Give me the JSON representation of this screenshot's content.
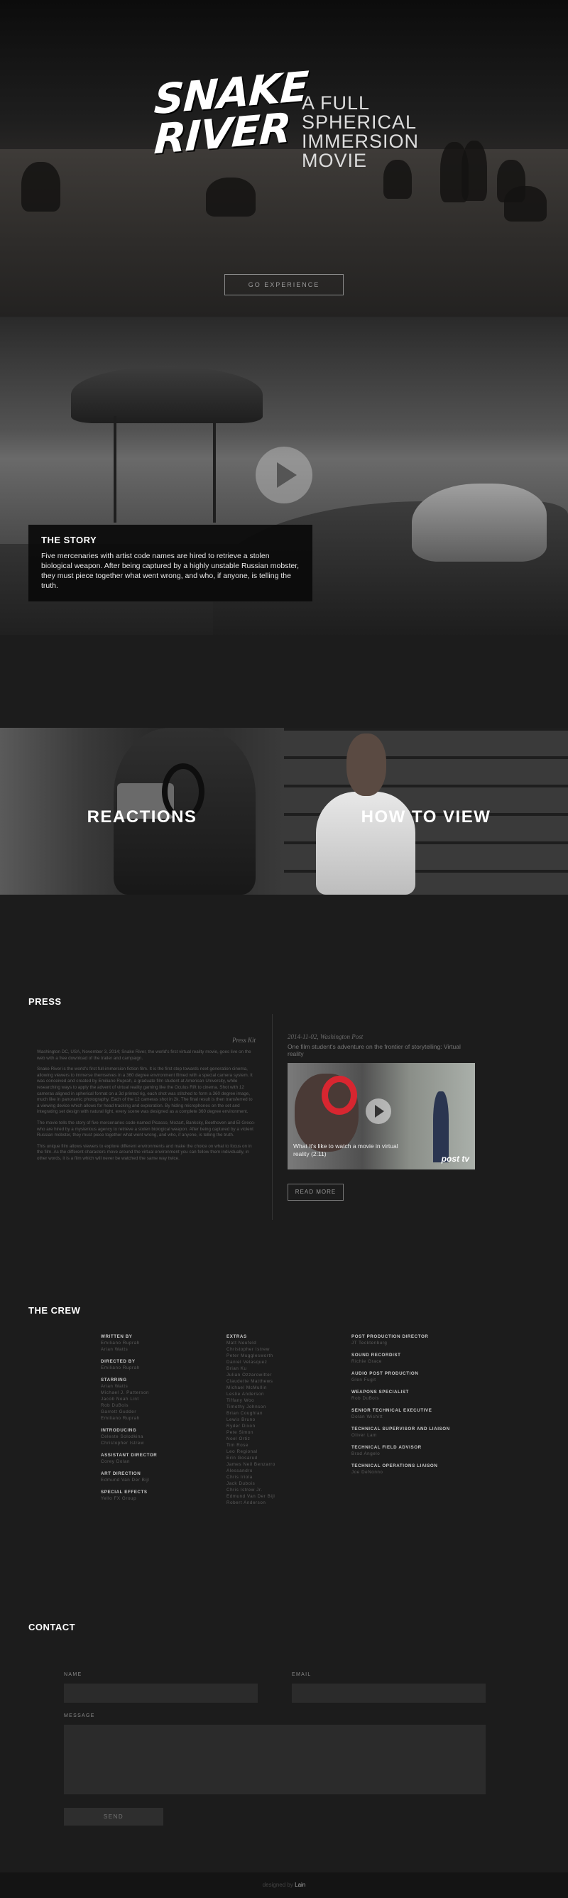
{
  "hero": {
    "logo_line1": "SNAKE",
    "logo_line2": "RIVER",
    "tagline": [
      "A FULL",
      "SPHERICAL",
      "IMMERSION",
      "MOVIE"
    ],
    "cta_label": "GO EXPERIENCE"
  },
  "story": {
    "title": "THE STORY",
    "text": "Five mercenaries with artist code names are hired to retrieve a stolen biological weapon. After being captured by a highly unstable Russian mobster, they must piece together what went wrong, and who, if anyone, is telling the truth."
  },
  "tiles": {
    "reactions": "REACTIONS",
    "how_to_view": "HOW TO VIEW"
  },
  "press": {
    "title": "PRESS",
    "kit_label": "Press Kit",
    "paragraphs": [
      "Washington DC, USA, November 3, 2014; Snake River, the world's first virtual reality movie, goes live on the web with a free download of the trailer and campaign.",
      "Snake River is the world's first full-immersion fiction film. It is the first step towards next generation cinema, allowing viewers to immerse themselves in a 360 degree environment filmed with a special camera system. It was conceived and created by Emiliano Ruprah, a graduate film student at American University, while researching ways to apply the advent of virtual reality gaming like the Oculus Rift to cinema. Shot with 12 cameras aligned in spherical format on a 3d printed rig, each shot was stitched to form a 360 degree image, much like in panoramic photography. Each of the 12 cameras shot in 2k. The final result is then transferred to a viewing device which allows for head tracking and exploration. By hiding microphones on the set and integrating set design with natural light, every scene was designed as a complete 360 degree environment.",
      "The movie tells the story of five mercenaries code-named Picasso, Mozart, Banksky, Beethoven and El Greco- who are hired by a mysterious agency to retrieve a stolen biological weapon. After being captured by a violent Russian mobster, they must piece together what went wrong, and who, if anyone, is telling the truth.",
      "This unique film allows viewers to explore different environments and make the choice on what to focus on in the film. As the different characters move around the virtual environment you can follow them individually, in other words, it is a film which will never be watched the same way twice."
    ],
    "article_date": "2014-11-02, Washington Post",
    "article_headline": "One film student's adventure on the frontier of storytelling: Virtual reality",
    "video_caption": "What it's like to watch a movie in virtual reality",
    "video_duration": "(2:11)",
    "video_brand": "post tv",
    "read_more": "READ MORE"
  },
  "crew": {
    "title": "THE CREW",
    "columns": [
      [
        {
          "role": "WRITTEN BY",
          "names": [
            "Emiliano Ruprah",
            "Arian Watts"
          ]
        },
        {
          "role": "DIRECTED BY",
          "names": [
            "Emiliano Ruprah"
          ]
        },
        {
          "role": "STARRING",
          "names": [
            "Arian Watts",
            "Michael J. Patterson",
            "Jacob Noah Lint",
            "Rob DuBois",
            "Garrett Gudder",
            "Emiliano Ruprah"
          ]
        },
        {
          "role": "INTRODUCING",
          "names": [
            "Celeste Solodkina",
            "Christopher Istrew"
          ]
        },
        {
          "role": "ASSISTANT DIRECTOR",
          "names": [
            "Corey Dolan"
          ]
        },
        {
          "role": "ART DIRECTION",
          "names": [
            "Edmund Van Der Bijl"
          ]
        },
        {
          "role": "SPECIAL EFFECTS",
          "names": [
            "Yello FX Group"
          ]
        }
      ],
      [
        {
          "role": "EXTRAS",
          "names": [
            "Matt Neufeld",
            "Christopher Istrew",
            "Peter Mugglesworth",
            "Daniel Velasquez",
            "Brian Ku",
            "Julian Ozzarowitter",
            "Claudette Matthews",
            "Michael McMullin",
            "Leslie Anderson",
            "Tiffany Woo",
            "Timothy Johnson",
            "Brian Coughlan",
            "Lewis Bruno",
            "Ryder Dixon",
            "Pete Simon",
            "Noel Ortiz",
            "Tim Rose",
            "Leo Regional",
            "Erin Gosarud",
            "James Neil Benzarro",
            "Alessandro",
            "Chris Iriola",
            "Jack Dubois",
            "Chris Istrew Jr.",
            "Edmund Van Der Bijl",
            "Robert Anderson"
          ]
        }
      ],
      [
        {
          "role": "POST PRODUCTION DIRECTOR",
          "names": [
            "JT Tecktenburg"
          ]
        },
        {
          "role": "SOUND RECORDIST",
          "names": [
            "Richie Grace"
          ]
        },
        {
          "role": "AUDIO POST PRODUCTION",
          "names": [
            "Glen Fugit"
          ]
        },
        {
          "role": "WEAPONS SPECIALIST",
          "names": [
            "Rob DuBois"
          ]
        },
        {
          "role": "SENIOR TECHNICAL EXECUTIVE",
          "names": [
            "Dolan Wishitt"
          ]
        },
        {
          "role": "TECHNICAL SUPERVISOR AND LIAISON",
          "names": [
            "Oliver Lam"
          ]
        },
        {
          "role": "TECHNICAL FIELD ADVISOR",
          "names": [
            "Brad Angelo"
          ]
        },
        {
          "role": "TECHNICAL OPERATIONS LIAISON",
          "names": [
            "Joe DeNonno"
          ]
        }
      ]
    ]
  },
  "contact": {
    "title": "CONTACT",
    "name_label": "NAME",
    "email_label": "EMAIL",
    "message_label": "MESSAGE",
    "send_label": "SEND"
  },
  "footer": {
    "prefix": "designed by",
    "author": "Lain"
  },
  "colors": {
    "background": "#1c1c1c",
    "field": "#2b2b2b",
    "accent_red": "#d82630"
  }
}
